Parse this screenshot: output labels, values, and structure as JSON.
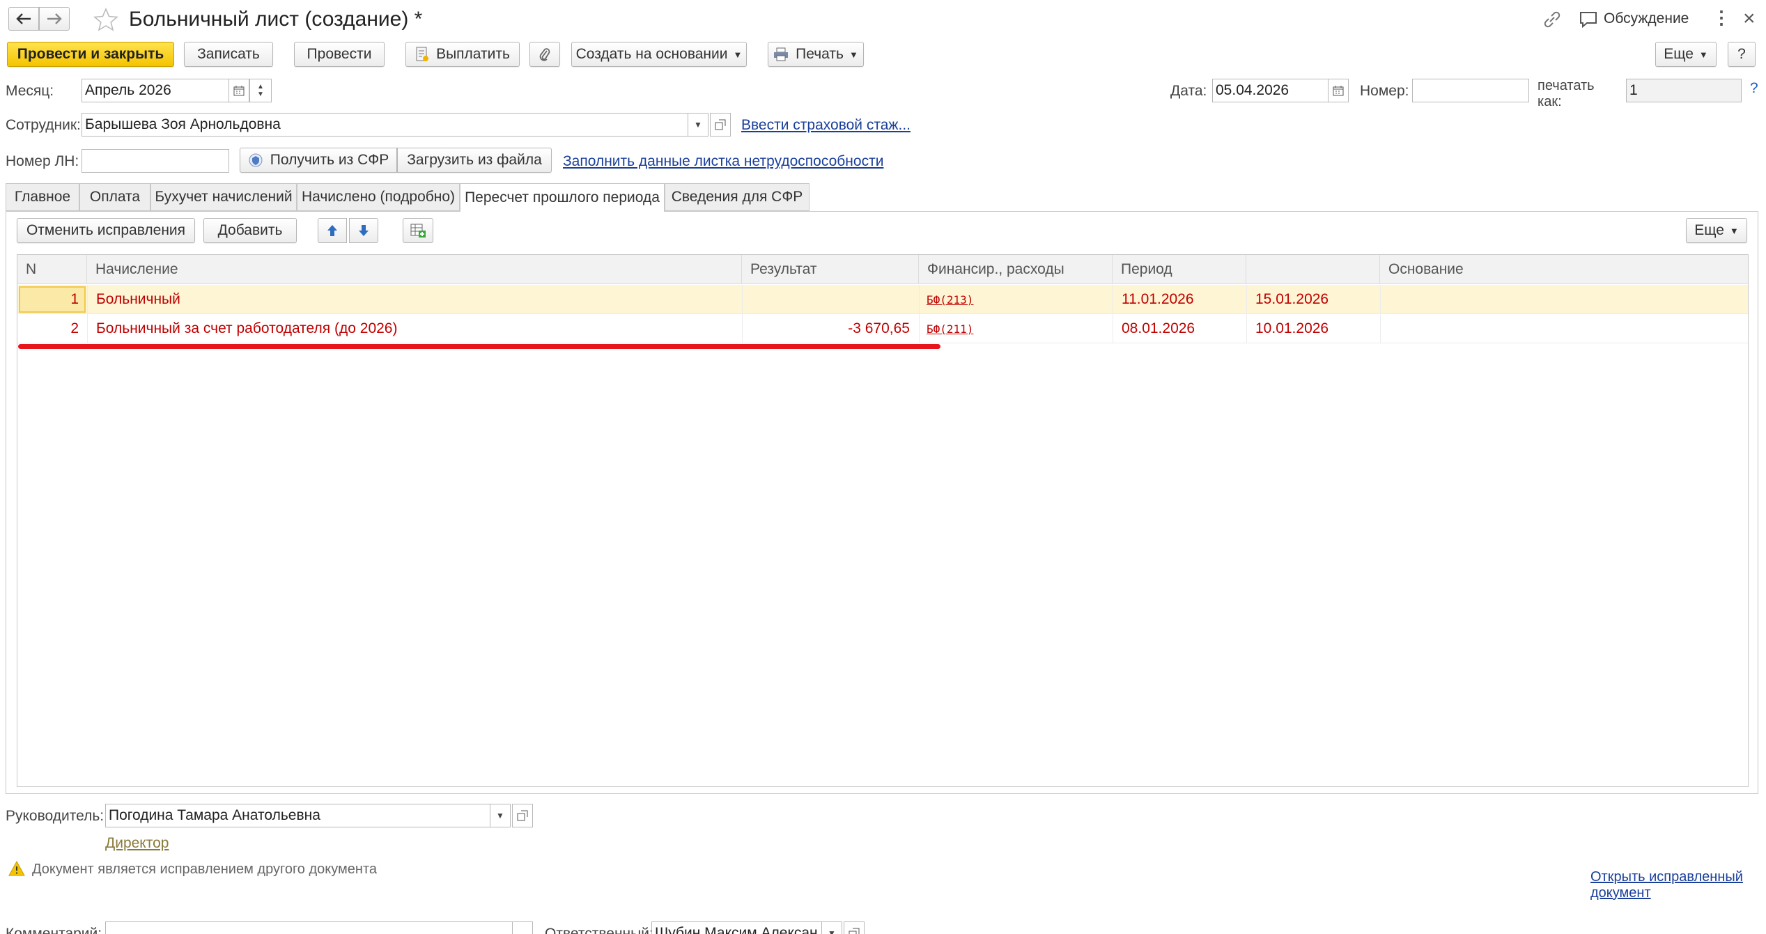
{
  "window": {
    "title": "Больничный лист (создание) *",
    "discussion_label": "Обсуждение"
  },
  "toolbar": {
    "post_close": "Провести и закрыть",
    "save": "Записать",
    "post": "Провести",
    "pay": "Выплатить",
    "create_based": "Создать на основании",
    "print": "Печать",
    "more": "Еще",
    "help": "?"
  },
  "form": {
    "month_label": "Месяц:",
    "month_value": "Апрель 2026",
    "date_label": "Дата:",
    "date_value": "05.04.2026",
    "number_label": "Номер:",
    "number_value": "",
    "print_as_label_1": "печатать",
    "print_as_label_2": "как:",
    "print_as_value": "1",
    "print_as_help": "?",
    "employee_label": "Сотрудник:",
    "employee_value": "Барышева Зоя Арнольдовна",
    "insurance_link": "Ввести страховой стаж...",
    "ln_label": "Номер ЛН:",
    "ln_value": "",
    "get_sfr": "Получить из СФР",
    "load_file": "Загрузить из файла",
    "fill_link": "Заполнить данные листка нетрудоспособности"
  },
  "tabs": [
    "Главное",
    "Оплата",
    "Бухучет начислений",
    "Начислено (подробно)",
    "Пересчет прошлого периода",
    "Сведения для СФР"
  ],
  "table_toolbar": {
    "cancel_fixes": "Отменить исправления",
    "add": "Добавить",
    "more": "Еще"
  },
  "table": {
    "headers": [
      "N",
      "Начисление",
      "Результат",
      "Финансир., расходы",
      "Период",
      "",
      "Основание"
    ],
    "rows": [
      {
        "n": "1",
        "name": "Больничный",
        "result": "",
        "fin": "БФ(213)",
        "from": "11.01.2026",
        "to": "15.01.2026",
        "basis": ""
      },
      {
        "n": "2",
        "name": "Больничный за счет работодателя (до 2026)",
        "result": "-3 670,65",
        "fin": "БФ(211)",
        "from": "08.01.2026",
        "to": "10.01.2026",
        "basis": ""
      }
    ]
  },
  "footer": {
    "manager_label": "Руководитель:",
    "manager_value": "Погодина Тамара Анатольевна",
    "manager_position": "Директор",
    "warning": "Документ является исправлением другого документа",
    "open_fixed_1": "Открыть исправленный",
    "open_fixed_2": "документ",
    "comment_label": "Комментарий:",
    "comment_value": "",
    "responsible_label": "Ответственный:",
    "responsible_value": "Шубин Максим Алексан"
  },
  "colors": {
    "accent_yellow": "#f5c400",
    "link": "#1a3f9a",
    "correction_red": "#c00000",
    "highlight_underline": "#e8141c",
    "selected_row": "#fdf5d4"
  }
}
